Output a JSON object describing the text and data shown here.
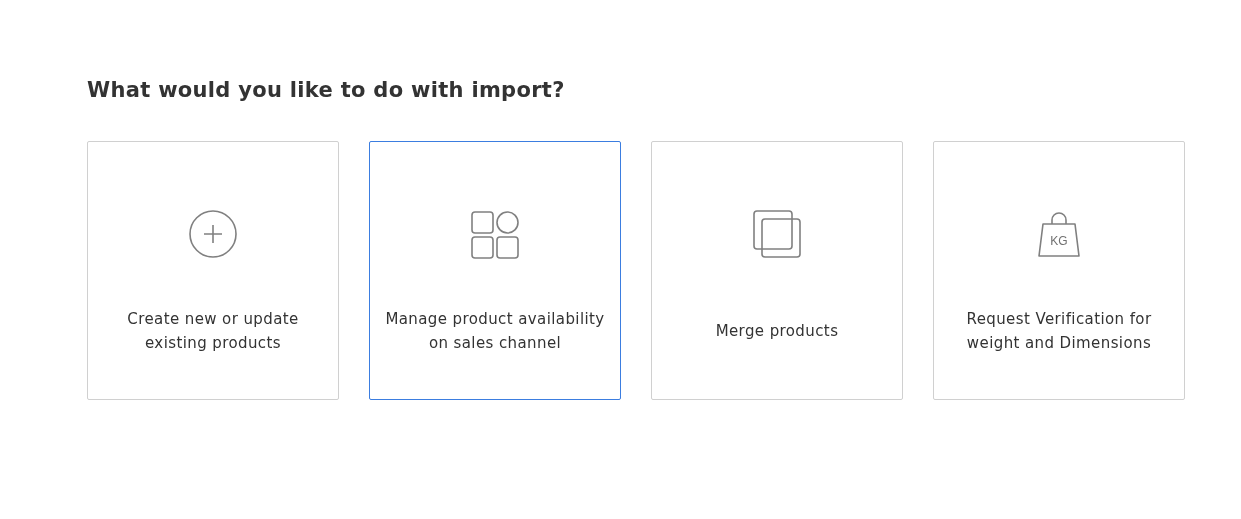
{
  "heading": "What would you like to do with import?",
  "options": [
    {
      "kind": "plus",
      "label": "Create new or update existing products",
      "selected": false
    },
    {
      "kind": "grid",
      "label": "Manage product availability on sales channel",
      "selected": true
    },
    {
      "kind": "merge",
      "label": "Merge products",
      "selected": false
    },
    {
      "kind": "weight",
      "icon_text": "KG",
      "label": "Request Verification for weight and Dimensions",
      "selected": false
    }
  ]
}
